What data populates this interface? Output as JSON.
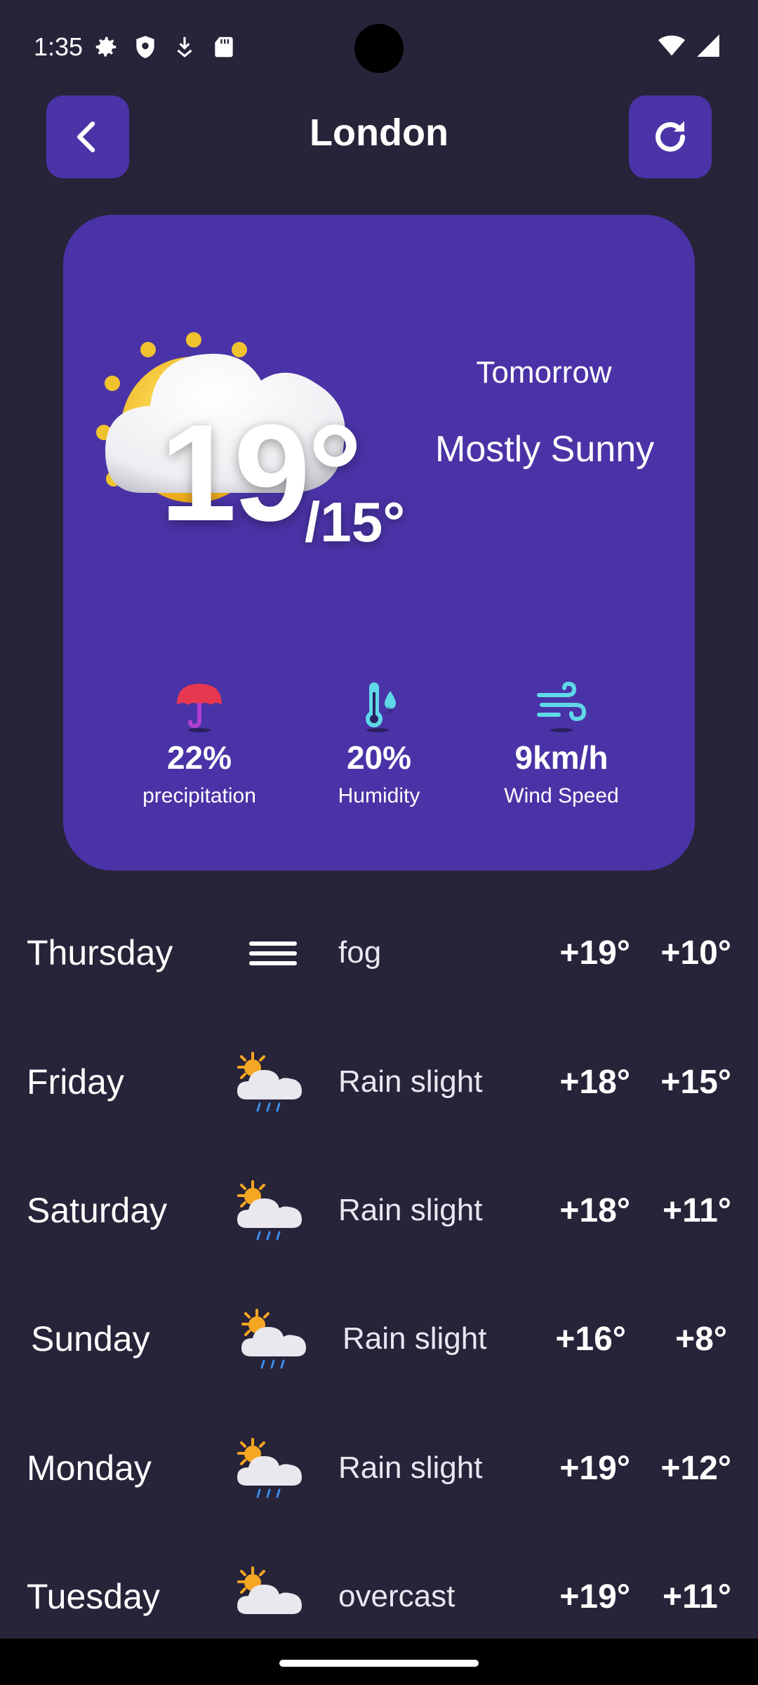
{
  "status_bar": {
    "time": "1:35",
    "icons": [
      "gear-icon",
      "shield-icon",
      "download-icon",
      "sd-card-icon",
      "wifi-icon",
      "signal-icon"
    ]
  },
  "header": {
    "title": "London",
    "back_icon": "chevron-left-icon",
    "refresh_icon": "refresh-icon"
  },
  "current": {
    "high": "19°",
    "low": "/15°",
    "day": "Tomorrow",
    "condition": "Mostly Sunny",
    "icon": "sun-behind-cloud-icon",
    "stats": [
      {
        "value": "22%",
        "label": "precipitation",
        "icon": "umbrella-icon"
      },
      {
        "value": "20%",
        "label": "Humidity",
        "icon": "thermometer-drop-icon"
      },
      {
        "value": "9km/h",
        "label": "Wind Speed",
        "icon": "wind-icon"
      }
    ]
  },
  "forecast": [
    {
      "day": "Thursday",
      "icon": "fog-icon",
      "condition": "fog",
      "high": "+19°",
      "low": "+10°"
    },
    {
      "day": "Friday",
      "icon": "sun-cloud-rain-icon",
      "condition": "Rain slight",
      "high": "+18°",
      "low": "+15°"
    },
    {
      "day": "Saturday",
      "icon": "sun-cloud-rain-icon",
      "condition": "Rain slight",
      "high": "+18°",
      "low": "+11°"
    },
    {
      "day": "Sunday",
      "icon": "sun-cloud-rain-icon",
      "condition": "Rain slight",
      "high": "+16°",
      "low": "+8°"
    },
    {
      "day": "Monday",
      "icon": "sun-cloud-rain-icon",
      "condition": "Rain slight",
      "high": "+19°",
      "low": "+12°"
    },
    {
      "day": "Tuesday",
      "icon": "sun-cloud-icon",
      "condition": "overcast",
      "high": "+19°",
      "low": "+11°"
    }
  ],
  "colors": {
    "background": "#272339",
    "card": "#4a33a6",
    "button": "#4b33a8",
    "sun": "#f5b82e",
    "rain": "#3d8ef0"
  }
}
